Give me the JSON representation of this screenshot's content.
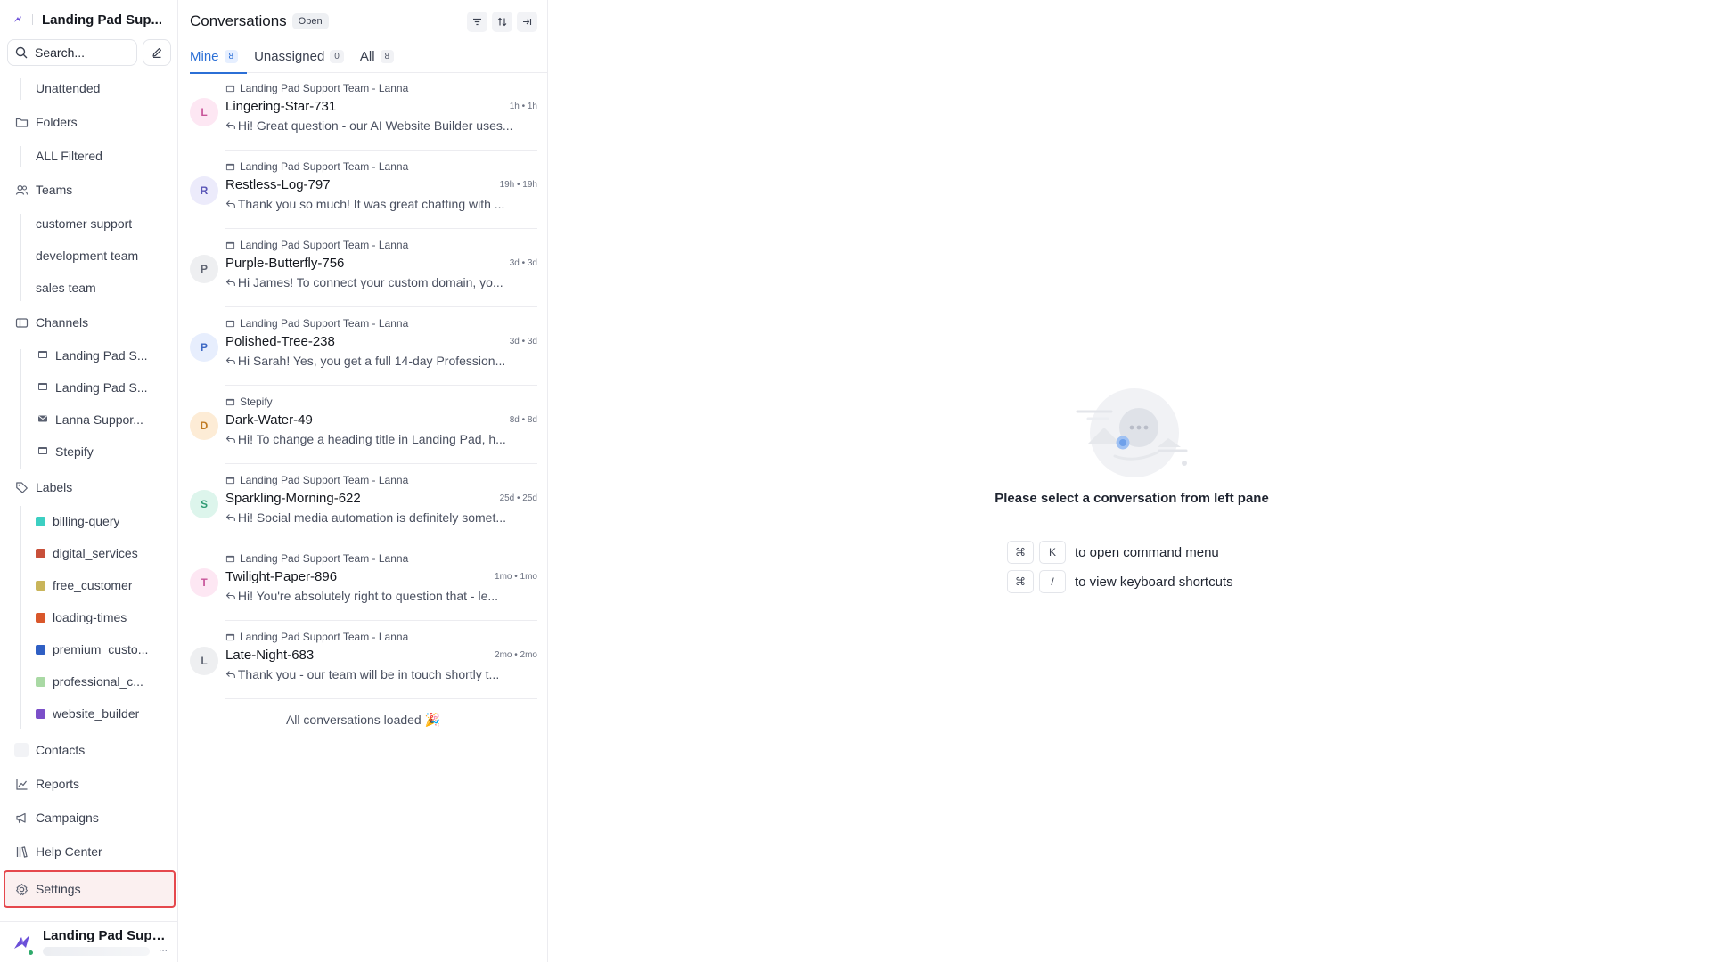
{
  "sidebar": {
    "brand_name": "Landing Pad Sup...",
    "search_placeholder": "Search...",
    "unattended": "Unattended",
    "folders": {
      "label": "Folders",
      "items": [
        "ALL Filtered"
      ]
    },
    "teams": {
      "label": "Teams",
      "items": [
        "customer support",
        "development team",
        "sales team"
      ]
    },
    "channels": {
      "label": "Channels",
      "items": [
        "Landing Pad S...",
        "Landing Pad S...",
        "Lanna Suppor...",
        "Stepify"
      ]
    },
    "labels": {
      "label": "Labels",
      "items": [
        {
          "name": "billing-query",
          "color": "#3ccfc2"
        },
        {
          "name": "digital_services",
          "color": "#c8503a"
        },
        {
          "name": "free_customer",
          "color": "#c9b55a"
        },
        {
          "name": "loading-times",
          "color": "#d9572b"
        },
        {
          "name": "premium_custo...",
          "color": "#2f5fc4"
        },
        {
          "name": "professional_c...",
          "color": "#a9d9a4"
        },
        {
          "name": "website_builder",
          "color": "#7b4fc9"
        }
      ]
    },
    "contacts": "Contacts",
    "reports": "Reports",
    "campaigns": "Campaigns",
    "help_center": "Help Center",
    "settings": "Settings",
    "profile_name": "Landing Pad Supp...",
    "profile_more": "..."
  },
  "conversations": {
    "title": "Conversations",
    "status": "Open",
    "tabs": [
      {
        "label": "Mine",
        "count": "8"
      },
      {
        "label": "Unassigned",
        "count": "0"
      },
      {
        "label": "All",
        "count": "8"
      }
    ],
    "items": [
      {
        "inbox": "Landing Pad Support Team - Lanna",
        "name": "Lingering-Star-731",
        "time": "1h • 1h",
        "message": "Hi! Great question - our AI Website Builder uses...",
        "initial": "L",
        "avatar_bg": "#fde7f3",
        "avatar_fg": "#c8559a"
      },
      {
        "inbox": "Landing Pad Support Team - Lanna",
        "name": "Restless-Log-797",
        "time": "19h • 19h",
        "message": "Thank you so much! It was great chatting with ...",
        "initial": "R",
        "avatar_bg": "#ecebfb",
        "avatar_fg": "#5b57b8"
      },
      {
        "inbox": "Landing Pad Support Team - Lanna",
        "name": "Purple-Butterfly-756",
        "time": "3d • 3d",
        "message": "Hi James! To connect your custom domain, yo...",
        "initial": "P",
        "avatar_bg": "#eeeff1",
        "avatar_fg": "#5f6472"
      },
      {
        "inbox": "Landing Pad Support Team - Lanna",
        "name": "Polished-Tree-238",
        "time": "3d • 3d",
        "message": "Hi Sarah! Yes, you get a full 14-day Profession...",
        "initial": "P",
        "avatar_bg": "#e7eefd",
        "avatar_fg": "#3d68c4"
      },
      {
        "inbox": "Stepify",
        "name": "Dark-Water-49",
        "time": "8d • 8d",
        "message": "Hi! To change a heading title in Landing Pad, h...",
        "initial": "D",
        "avatar_bg": "#fdecd6",
        "avatar_fg": "#c07a22"
      },
      {
        "inbox": "Landing Pad Support Team - Lanna",
        "name": "Sparkling-Morning-622",
        "time": "25d • 25d",
        "message": "Hi! Social media automation is definitely somet...",
        "initial": "S",
        "avatar_bg": "#ddf5ec",
        "avatar_fg": "#2e9a73"
      },
      {
        "inbox": "Landing Pad Support Team - Lanna",
        "name": "Twilight-Paper-896",
        "time": "1mo • 1mo",
        "message": "Hi! You're absolutely right to question that - le...",
        "initial": "T",
        "avatar_bg": "#fde7f3",
        "avatar_fg": "#c8559a"
      },
      {
        "inbox": "Landing Pad Support Team - Lanna",
        "name": "Late-Night-683",
        "time": "2mo • 2mo",
        "message": "Thank you - our team will be in touch shortly t...",
        "initial": "L",
        "avatar_bg": "#eeeff1",
        "avatar_fg": "#5f6472"
      }
    ],
    "all_loaded": "All conversations loaded 🎉"
  },
  "empty_state": {
    "message": "Please select a conversation from left pane",
    "shortcuts": [
      {
        "key": "K",
        "label": "to open command menu"
      },
      {
        "key": "/",
        "label": "to view keyboard shortcuts"
      }
    ]
  },
  "colors": {
    "accent": "#2b6fd6",
    "highlight_border": "#e5484d"
  }
}
